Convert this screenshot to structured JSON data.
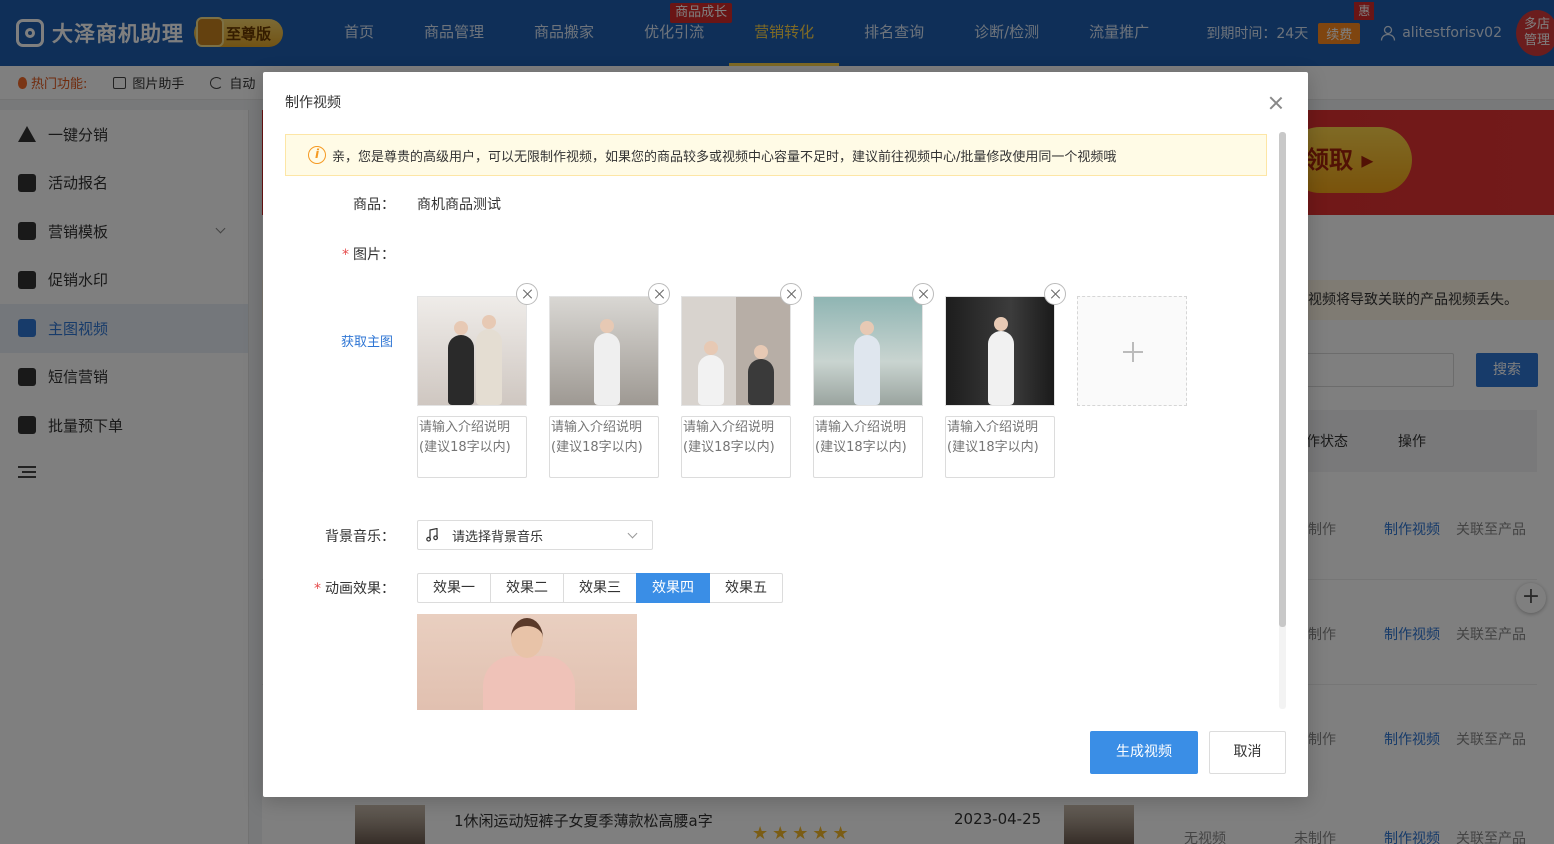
{
  "header": {
    "app_name": "大泽商机助理",
    "edition": "至尊版",
    "nav": [
      {
        "label": "首页"
      },
      {
        "label": "商品管理"
      },
      {
        "label": "商品搬家"
      },
      {
        "label": "优化引流",
        "badge": "商品成长"
      },
      {
        "label": "营销转化",
        "active": true
      },
      {
        "label": "排名查询"
      },
      {
        "label": "诊断/检测"
      },
      {
        "label": "流量推广"
      }
    ],
    "expire_text": "到期时间：24天",
    "renew_label": "续费",
    "renew_badge": "惠",
    "username": "alitestforisv02",
    "multi_store": "多店管理"
  },
  "hotbar": {
    "label": "热门功能:",
    "items": [
      "图片助手",
      "自动"
    ]
  },
  "sidebar": {
    "items": [
      {
        "label": "一键分销",
        "icon": "warning-icon"
      },
      {
        "label": "活动报名",
        "icon": "flag-icon"
      },
      {
        "label": "营销模板",
        "icon": "chart-icon",
        "expandable": true
      },
      {
        "label": "促销水印",
        "icon": "stamp-icon"
      },
      {
        "label": "主图视频",
        "icon": "video-icon",
        "active": true
      },
      {
        "label": "短信营销",
        "icon": "message-icon"
      },
      {
        "label": "批量预下单",
        "icon": "document-icon"
      }
    ]
  },
  "background": {
    "banner_button": "领取",
    "warning_text": "视频将导致关联的产品视频丢失。",
    "search_label": "搜索",
    "columns": [
      "作状态",
      "操作"
    ],
    "rows": [
      {
        "status": "制作",
        "action1": "制作视频",
        "action2": "关联至产品"
      },
      {
        "status": "制作",
        "action1": "制作视频",
        "action2": "关联至产品"
      },
      {
        "status": "制作",
        "action1": "制作视频",
        "action2": "关联至产品"
      }
    ],
    "bottom_row": {
      "title": "1休闲运动短裤子女夏季薄款松高腰a字",
      "date": "2023-04-25",
      "video_status": "无视频",
      "make_status": "未制作",
      "action1": "制作视频",
      "action2": "关联至产品"
    }
  },
  "modal": {
    "title": "制作视频",
    "notice": "亲，您是尊贵的高级用户，可以无限制作视频，如果您的商品较多或视频中心容量不足时，建议前往视频中心/批量修改使用同一个视频哦",
    "product_label": "商品：",
    "product_value": "商机商品测试",
    "images_label": "图片：",
    "fetch_main_image": "获取主图",
    "desc_placeholder": "请输入介绍说明(建议18字以内)",
    "images": [
      {
        "name": "product-photo-1"
      },
      {
        "name": "product-photo-2"
      },
      {
        "name": "product-photo-3"
      },
      {
        "name": "product-photo-4"
      },
      {
        "name": "product-photo-5"
      }
    ],
    "music_label": "背景音乐：",
    "music_placeholder": "请选择背景音乐",
    "effect_label": "动画效果：",
    "effects": [
      "效果一",
      "效果二",
      "效果三",
      "效果四",
      "效果五"
    ],
    "selected_effect": "效果四",
    "generate_button": "生成视频",
    "cancel_button": "取消"
  },
  "colors": {
    "header_bg": "#1e5fb0",
    "primary": "#3a8ee6",
    "nav_active": "#ffd54a",
    "danger": "#d42a2a",
    "notice_bg": "#fffbe6"
  }
}
